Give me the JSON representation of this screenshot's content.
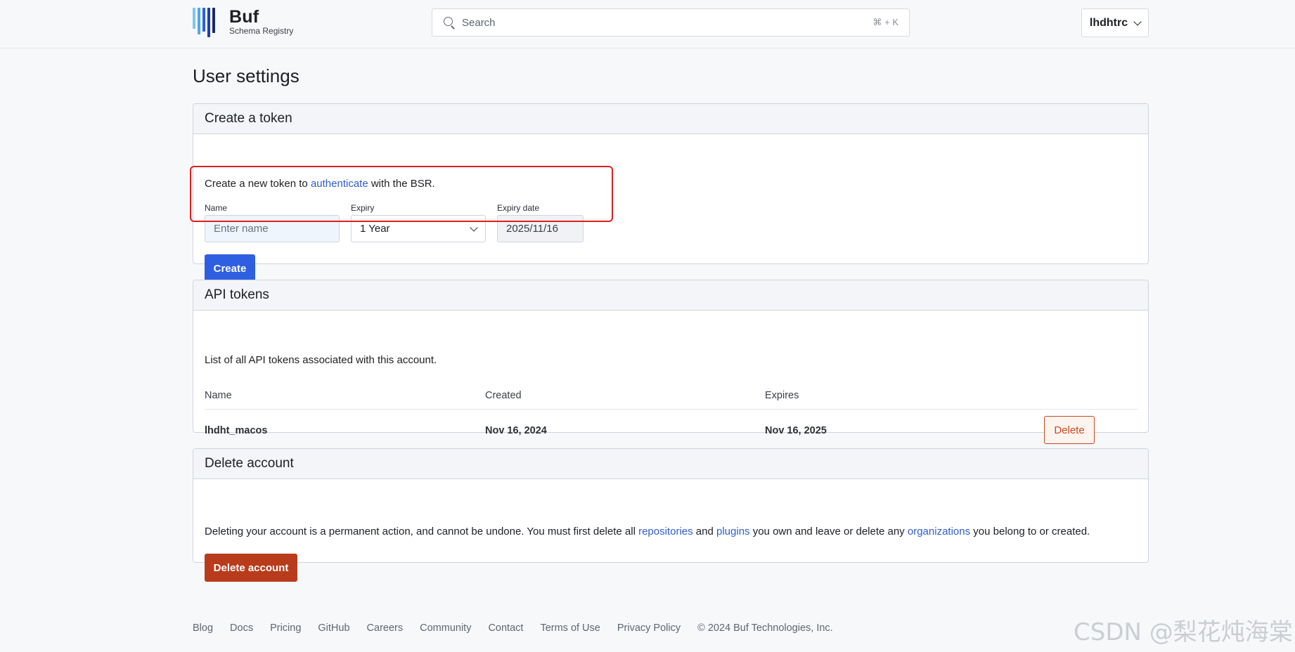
{
  "brand": {
    "title": "Buf",
    "subtitle": "Schema Registry"
  },
  "search": {
    "placeholder": "Search",
    "shortcut": "⌘ + K"
  },
  "user_menu": {
    "username": "lhdhtrc"
  },
  "page": {
    "title": "User settings"
  },
  "create_token": {
    "heading": "Create a token",
    "desc_prefix": "Create a new token to ",
    "desc_link": "authenticate",
    "desc_suffix": " with the BSR.",
    "name_label": "Name",
    "name_placeholder": "Enter name",
    "expiry_label": "Expiry",
    "expiry_value": "1 Year",
    "expiry_date_label": "Expiry date",
    "expiry_date_value": "2025/11/16",
    "create_button": "Create"
  },
  "api_tokens": {
    "heading": "API tokens",
    "description": "List of all API tokens associated with this account.",
    "columns": [
      "Name",
      "Created",
      "Expires"
    ],
    "rows": [
      {
        "name": "lhdht_macos",
        "created": "Nov 16, 2024",
        "expires": "Nov 16, 2025",
        "action": "Delete"
      }
    ]
  },
  "delete_account": {
    "heading": "Delete account",
    "desc_1": "Deleting your account is a permanent action, and cannot be undone. You must first delete all ",
    "link_repositories": "repositories",
    "desc_2": " and ",
    "link_plugins": "plugins",
    "desc_3": " you own and leave or delete any ",
    "link_organizations": "organizations",
    "desc_4": " you belong to or created.",
    "button": "Delete account"
  },
  "footer": {
    "links": [
      "Blog",
      "Docs",
      "Pricing",
      "GitHub",
      "Careers",
      "Community",
      "Contact",
      "Terms of Use",
      "Privacy Policy"
    ],
    "copyright": "© 2024 Buf Technologies, Inc."
  },
  "watermark": "CSDN @梨花炖海棠",
  "colors": {
    "primary": "#2e5ee1",
    "danger": "#b83c1c",
    "link": "#2f5ccf",
    "highlight": "#e0201f"
  }
}
